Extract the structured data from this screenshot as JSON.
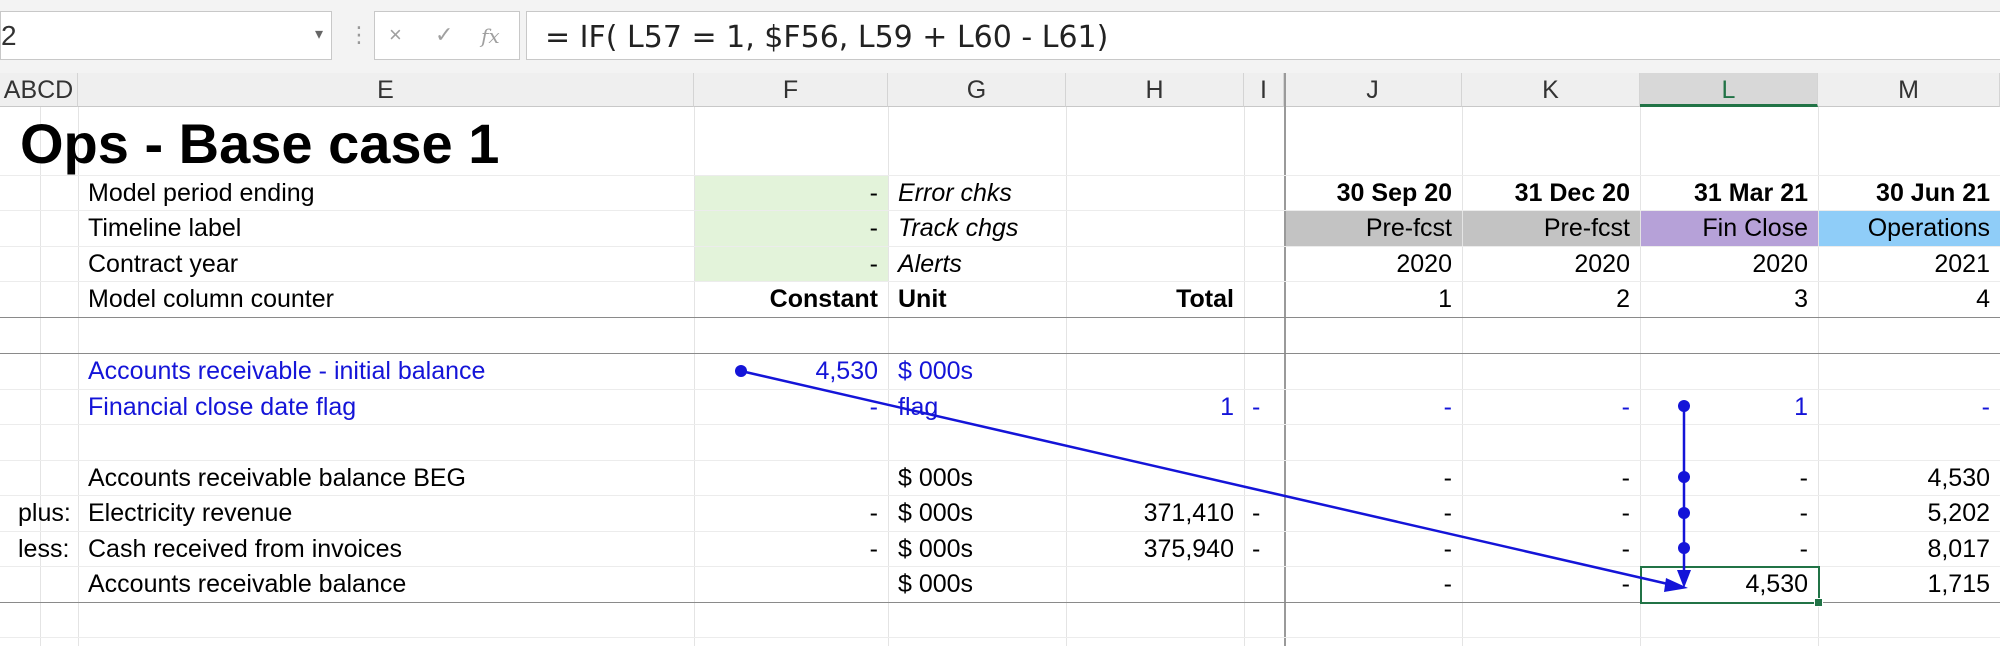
{
  "formula_bar": {
    "name_box": "2",
    "cancel_icon": "×",
    "enter_icon": "✓",
    "fx_icon": "fx",
    "formula": "= IF( L57 = 1, $F56, L59 + L60 - L61)"
  },
  "columns": [
    "ABCD",
    "E",
    "F",
    "G",
    "H",
    "I",
    "J",
    "K",
    "L",
    "M"
  ],
  "selected_column": "L",
  "sheet": {
    "title": "Ops - Base case 1",
    "header_rows": [
      {
        "label": "Model period ending",
        "f": "-",
        "g": "Error chks",
        "j": "30 Sep 20",
        "k": "31 Dec 20",
        "l": "31 Mar 21",
        "m": "30 Jun 21"
      },
      {
        "label": "Timeline label",
        "f": "-",
        "g": "Track chgs",
        "j": "Pre-fcst",
        "k": "Pre-fcst",
        "l": "Fin Close",
        "m": "Operations"
      },
      {
        "label": "Contract year",
        "f": "-",
        "g": "Alerts",
        "j": "2020",
        "k": "2020",
        "l": "2020",
        "m": "2021"
      },
      {
        "label": "Model column counter",
        "f": "Constant",
        "g": "Unit",
        "h": "Total",
        "j": "1",
        "k": "2",
        "l": "3",
        "m": "4"
      }
    ],
    "input_rows": [
      {
        "label": "Accounts receivable - initial balance",
        "f": "4,530",
        "g": "$ 000s"
      },
      {
        "label": "Financial close date flag",
        "f": "-",
        "g": "flag",
        "h": "1",
        "i": "-",
        "j": "-",
        "k": "-",
        "l": "1",
        "m": "-"
      }
    ],
    "calc_rows": [
      {
        "prefix": "",
        "label": "Accounts receivable balance BEG",
        "f": "",
        "g": "$ 000s",
        "h": "",
        "i": "",
        "j": "-",
        "k": "-",
        "l": "-",
        "m": "4,530"
      },
      {
        "prefix": "plus:",
        "label": "Electricity revenue",
        "f": "-",
        "g": "$ 000s",
        "h": "371,410",
        "i": "-",
        "j": "-",
        "k": "-",
        "l": "-",
        "m": "5,202"
      },
      {
        "prefix": "less:",
        "label": "Cash received from invoices",
        "f": "-",
        "g": "$ 000s",
        "h": "375,940",
        "i": "-",
        "j": "-",
        "k": "-",
        "l": "-",
        "m": "8,017"
      },
      {
        "prefix": "",
        "label": "Accounts receivable balance",
        "f": "",
        "g": "$ 000s",
        "h": "",
        "i": "",
        "j": "-",
        "k": "-",
        "l": "4,530",
        "m": "1,715"
      }
    ]
  },
  "colors": {
    "input_fill": "#e3f3da",
    "prefcst_fill": "#c3c3c3",
    "finclose_fill": "#b6a1d8",
    "operations_fill": "#8fcdf8",
    "input_text": "#1414d8",
    "trace_arrow": "#1414d8",
    "selection": "#217346"
  }
}
